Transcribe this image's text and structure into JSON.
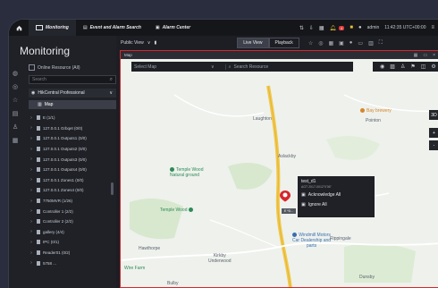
{
  "topbar": {
    "tabs": [
      {
        "label": "Monitoring",
        "icon": "monitor-icon",
        "active": true
      },
      {
        "label": "Event and Alarm Search",
        "icon": "search-doc-icon",
        "active": false
      },
      {
        "label": "Alarm Center",
        "icon": "alarm-center-icon",
        "active": false
      }
    ],
    "badge_count": "4",
    "user": "admin",
    "clock": "11:42:35 UTC+00:00"
  },
  "left": {
    "title": "Monitoring",
    "online_label": "Online Resource (All)",
    "search_placeholder": "Search",
    "site": "HikCentral Professional",
    "map_item": "Map",
    "tree": [
      "E (1/1)",
      "127.0.0.1 Grbqet (0/0)",
      "127.0.0.1 Outputs1 (0/0)",
      "127.0.0.1 Outputs2 (0/0)",
      "127.0.0.1 Outputs3 (0/0)",
      "127.0.0.1 Outputs4 (0/0)",
      "127.0.0.1 Zones1 (0/0)",
      "127.0.0.1 Zones4 (0/0)",
      "7750MVR (1/26)",
      "Controller 1 (2/2)",
      "Controller 2 (2/2)",
      "gallery (4/4)",
      "IPC (0/1)",
      "Reader01 (0/2)",
      "5758 ..."
    ]
  },
  "viewbar": {
    "public_view": "Public View",
    "live_view": "Live View",
    "playback": "Playback"
  },
  "map": {
    "header": "Map",
    "select_placeholder": "Select Map",
    "search_placeholder": "Search Resource",
    "zoom_3d": "3D",
    "zoom_in": "+",
    "zoom_out": "-",
    "places": {
      "laughton": "Laughton",
      "asladby": "Aslackby",
      "temple_wood_nature": "Temple Wood\nNatural ground",
      "temple_wood": "Temple Wood",
      "hawthorpe": "Hawthorpe",
      "windmill": "Windmill Motors\nCar Dealership and\nparts",
      "rippingale": "Rippingale",
      "kirkby": "Kirkby\nUnderwood",
      "bulby": "Bulby",
      "dunsby": "Dunsby",
      "pointon": "Pointon",
      "bay_brewery": "Bay brewery",
      "ww_farm": "Wire Farm"
    },
    "popup": {
      "title": "test_d1",
      "subtitle": "AGT 2017-0012\"0'06\"",
      "ack": "Acknowledge All",
      "ignore": "Ignore All"
    },
    "pin_label": "E *D..."
  }
}
